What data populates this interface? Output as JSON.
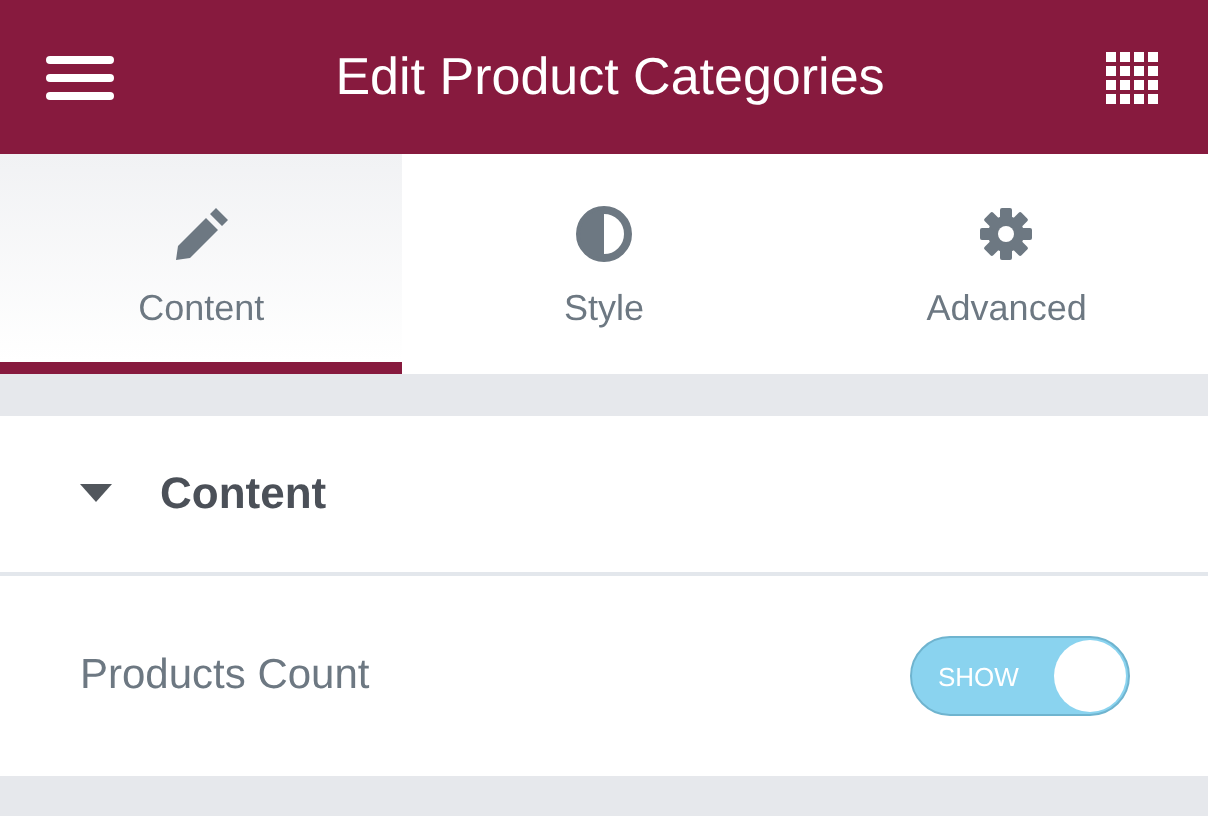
{
  "header": {
    "title": "Edit Product Categories"
  },
  "tabs": [
    {
      "label": "Content",
      "selected": true
    },
    {
      "label": "Style",
      "selected": false
    },
    {
      "label": "Advanced",
      "selected": false
    }
  ],
  "section": {
    "title": "Content",
    "expanded": true,
    "controls": [
      {
        "label": "Products Count",
        "on": true,
        "toggle_label": "SHOW"
      }
    ]
  }
}
